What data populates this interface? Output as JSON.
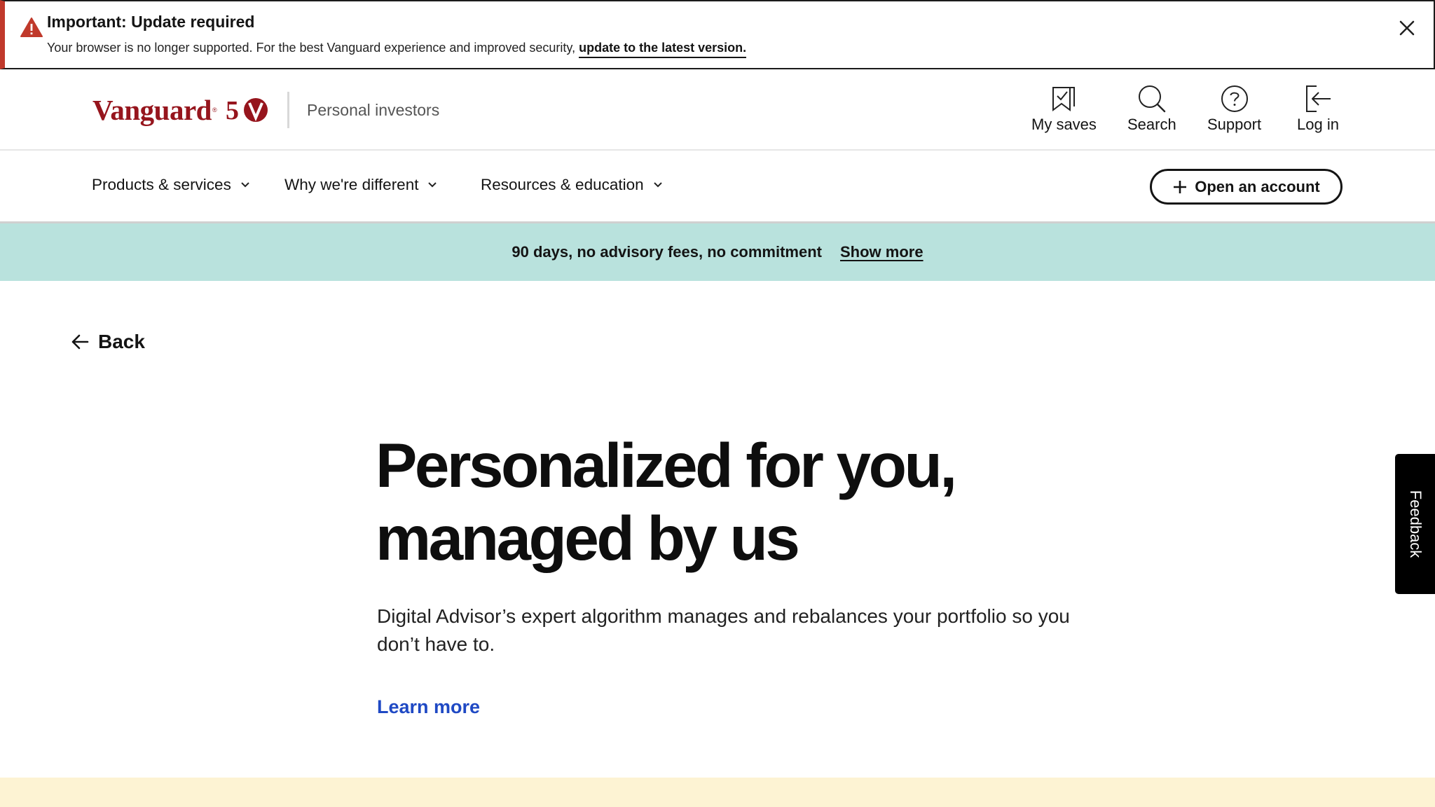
{
  "alert": {
    "title": "Important: Update required",
    "body": "Your browser is no longer supported. For the best Vanguard experience and improved security,",
    "link": "update to the latest version.",
    "accent_color": "#c0392b",
    "icon": "warning-icon",
    "close_icon": "close-icon"
  },
  "header": {
    "brand": "Vanguard",
    "brand_mark": "®",
    "anniversary": "50",
    "subtitle": "Personal investors",
    "brand_color": "#96151d",
    "utility_nav": [
      {
        "label": "My saves",
        "icon": "bookmark-icon"
      },
      {
        "label": "Search",
        "icon": "search-icon"
      },
      {
        "label": "Support",
        "icon": "help-icon"
      },
      {
        "label": "Log in",
        "icon": "login-icon"
      }
    ]
  },
  "nav": {
    "items": [
      {
        "label": "Products & services"
      },
      {
        "label": "Why we're different"
      },
      {
        "label": "Resources & education"
      }
    ],
    "cta": "Open an account"
  },
  "promo": {
    "text": "90 days, no advisory fees, no commitment",
    "link": "Show more",
    "background": "#b9e2dd"
  },
  "back": {
    "label": "Back"
  },
  "hero": {
    "title_line1": "Personalized for you,",
    "title_line2": "managed by us",
    "description": "Digital Advisor’s expert algorithm manages and rebalances your portfolio so you don’t have to.",
    "link": "Learn more",
    "link_color": "#1f49c4"
  },
  "feedback": {
    "label": "Feedback"
  }
}
